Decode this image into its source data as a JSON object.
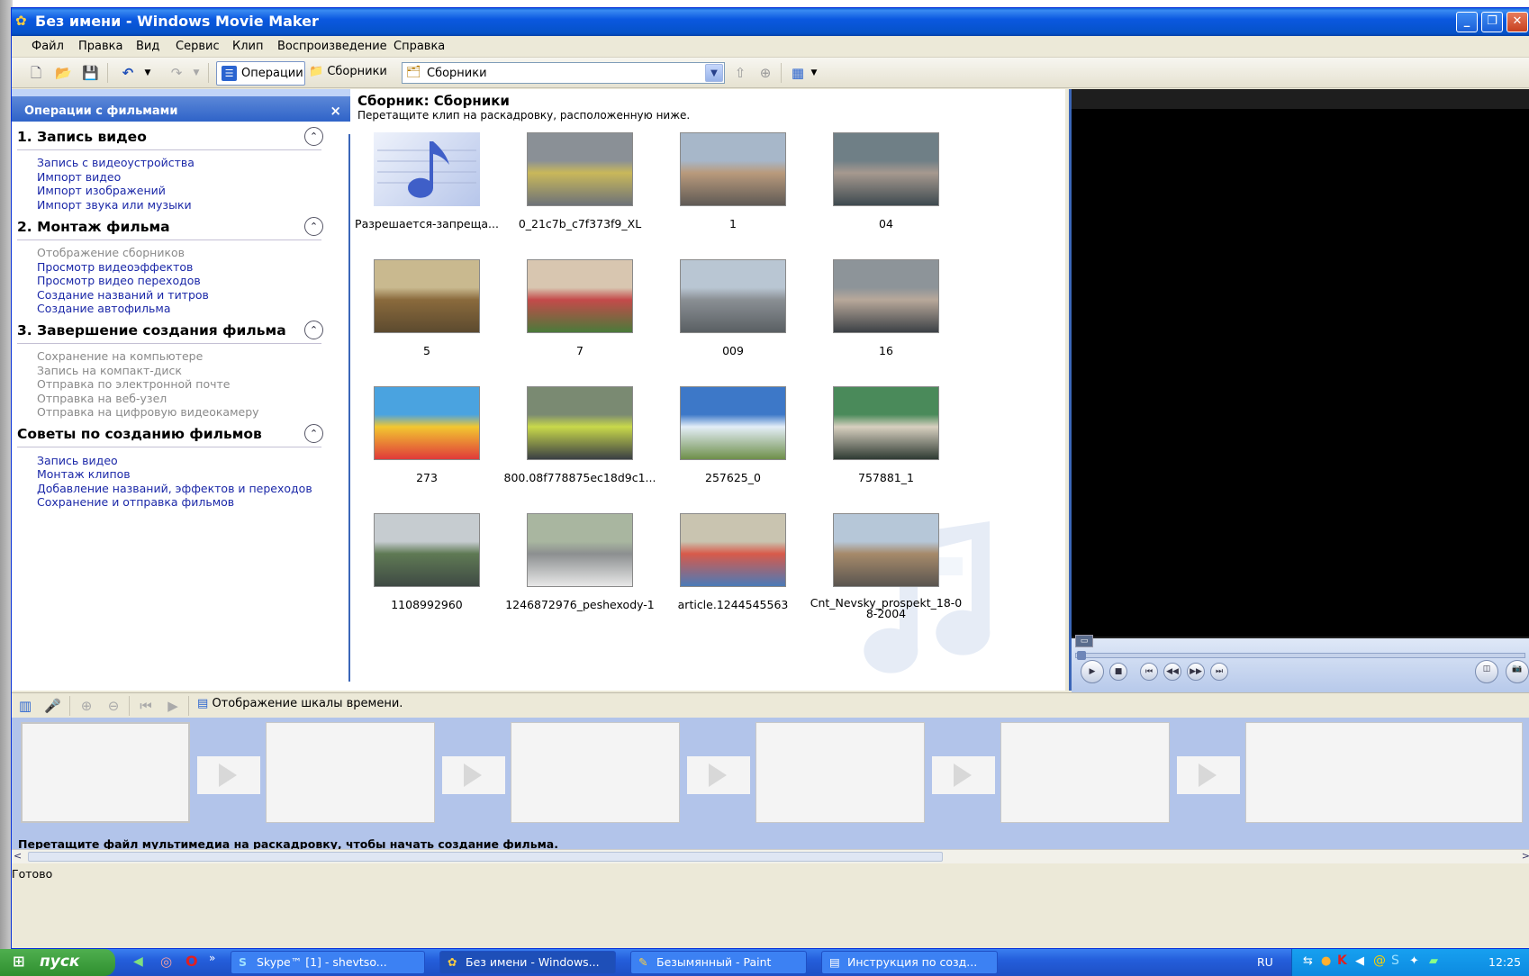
{
  "window": {
    "title": "Без имени - Windows Movie Maker"
  },
  "menu": [
    "Файл",
    "Правка",
    "Вид",
    "Сервис",
    "Клип",
    "Воспроизведение",
    "Справка"
  ],
  "toolbar": {
    "operations_label": "Операции",
    "collections_label": "Сборники",
    "collection_combo_value": "Сборники"
  },
  "tasks_panel": {
    "title": "Операции с фильмами",
    "sections": [
      {
        "title": "1. Запись видео",
        "links": [
          {
            "label": "Запись с видеоустройства",
            "enabled": true
          },
          {
            "label": "Импорт видео",
            "enabled": true
          },
          {
            "label": "Импорт изображений",
            "enabled": true
          },
          {
            "label": "Импорт звука или музыки",
            "enabled": true
          }
        ]
      },
      {
        "title": "2. Монтаж фильма",
        "links": [
          {
            "label": "Отображение сборников",
            "enabled": false
          },
          {
            "label": "Просмотр видеоэффектов",
            "enabled": true
          },
          {
            "label": "Просмотр видео переходов",
            "enabled": true
          },
          {
            "label": "Создание названий и титров",
            "enabled": true
          },
          {
            "label": "Создание автофильма",
            "enabled": true
          }
        ]
      },
      {
        "title": "3. Завершение создания фильма",
        "links": [
          {
            "label": "Сохранение на компьютере",
            "enabled": false
          },
          {
            "label": "Запись на компакт-диск",
            "enabled": false
          },
          {
            "label": "Отправка по электронной почте",
            "enabled": false
          },
          {
            "label": "Отправка на веб-узел",
            "enabled": false
          },
          {
            "label": "Отправка на цифровую видеокамеру",
            "enabled": false
          }
        ]
      },
      {
        "title": "Советы по созданию фильмов",
        "links": [
          {
            "label": "Запись видео",
            "enabled": true
          },
          {
            "label": "Монтаж клипов",
            "enabled": true
          },
          {
            "label": "Добавление названий, эффектов и переходов",
            "enabled": true
          },
          {
            "label": "Сохранение и отправка фильмов",
            "enabled": true
          }
        ]
      }
    ]
  },
  "collection": {
    "title": "Сборник: Сборники",
    "hint": "Перетащите клип на раскадровку, расположенную ниже.",
    "items": [
      {
        "name": "Разрешается-запреща...",
        "kind": "audio"
      },
      {
        "name": "0_21c7b_c7f373f9_XL",
        "kind": "photo",
        "colors": [
          "#8a9096",
          "#c9b85a",
          "#6d7278"
        ]
      },
      {
        "name": "1",
        "kind": "photo",
        "colors": [
          "#a7b7c9",
          "#b99a7c",
          "#5f5a55"
        ]
      },
      {
        "name": "04",
        "kind": "photo",
        "colors": [
          "#6f7f86",
          "#a6998f",
          "#3e4a50"
        ]
      },
      {
        "name": "5",
        "kind": "photo",
        "colors": [
          "#c9b98f",
          "#8a6a3c",
          "#5c4a2f"
        ]
      },
      {
        "name": "7",
        "kind": "photo",
        "colors": [
          "#d8c6b0",
          "#c44a4a",
          "#4a7a3a"
        ]
      },
      {
        "name": "009",
        "kind": "photo",
        "colors": [
          "#b9c6d3",
          "#8a8f94",
          "#5a5f63"
        ]
      },
      {
        "name": "16",
        "kind": "photo",
        "colors": [
          "#8d9499",
          "#b8a89a",
          "#3c4146"
        ]
      },
      {
        "name": "273",
        "kind": "photo",
        "colors": [
          "#4aa3e0",
          "#f2c830",
          "#e03a3a"
        ]
      },
      {
        "name": "800.08f778875ec18d9c1...",
        "kind": "photo",
        "colors": [
          "#7a8a72",
          "#c9d94a",
          "#3a3f44"
        ]
      },
      {
        "name": "257625_0",
        "kind": "photo",
        "colors": [
          "#3d78c8",
          "#e4eef8",
          "#6e8f4a"
        ]
      },
      {
        "name": "757881_1",
        "kind": "photo",
        "colors": [
          "#4a8a5a",
          "#d8d0c0",
          "#2f3b33"
        ]
      },
      {
        "name": "1108992960",
        "kind": "photo",
        "colors": [
          "#c6ccd0",
          "#5f7a54",
          "#3f4a44"
        ]
      },
      {
        "name": "1246872976_peshexody-1",
        "kind": "photo",
        "colors": [
          "#a9b6a0",
          "#8c8f90",
          "#e8e8e8"
        ]
      },
      {
        "name": "article.1244545563",
        "kind": "photo",
        "colors": [
          "#c9c4b0",
          "#d85a4a",
          "#4a7ab8"
        ]
      },
      {
        "name": "Cnt_Nevsky_prospekt_18-08-2004",
        "kind": "photo",
        "colors": [
          "#b6c7d8",
          "#a68a6a",
          "#5a5550"
        ]
      }
    ]
  },
  "storyboard": {
    "view_toggle_label": "Отображение шкалы времени.",
    "hint": "Перетащите файл мультимедиа на раскадровку, чтобы начать создание фильма."
  },
  "status": "Готово",
  "taskbar": {
    "start": "пуск",
    "tasks": [
      "Skype™ [1] - shevtso...",
      "Без имени - Windows...",
      "Безымянный - Paint",
      "Инструкция по созд..."
    ],
    "lang": "RU",
    "clock": "12:25"
  }
}
